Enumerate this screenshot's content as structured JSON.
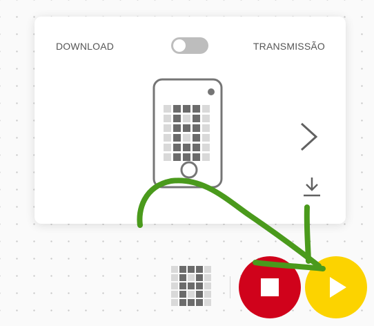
{
  "card": {
    "mode_left_label": "DOWNLOAD",
    "mode_right_label": "TRANSMISSÃO",
    "toggle_state": "off"
  },
  "icons": {
    "phone": "phone-with-led-grid-icon",
    "next": "chevron-right-icon",
    "download": "download-icon",
    "grid": "led-grid-icon",
    "stop": "stop-icon",
    "play": "play-icon"
  },
  "colors": {
    "stop_button": "#d0021b",
    "play_button": "#fcd300",
    "annotation_arrow": "#4a9a1c",
    "toggle_track": "#bdbdbd",
    "icon_gray": "#757575"
  }
}
